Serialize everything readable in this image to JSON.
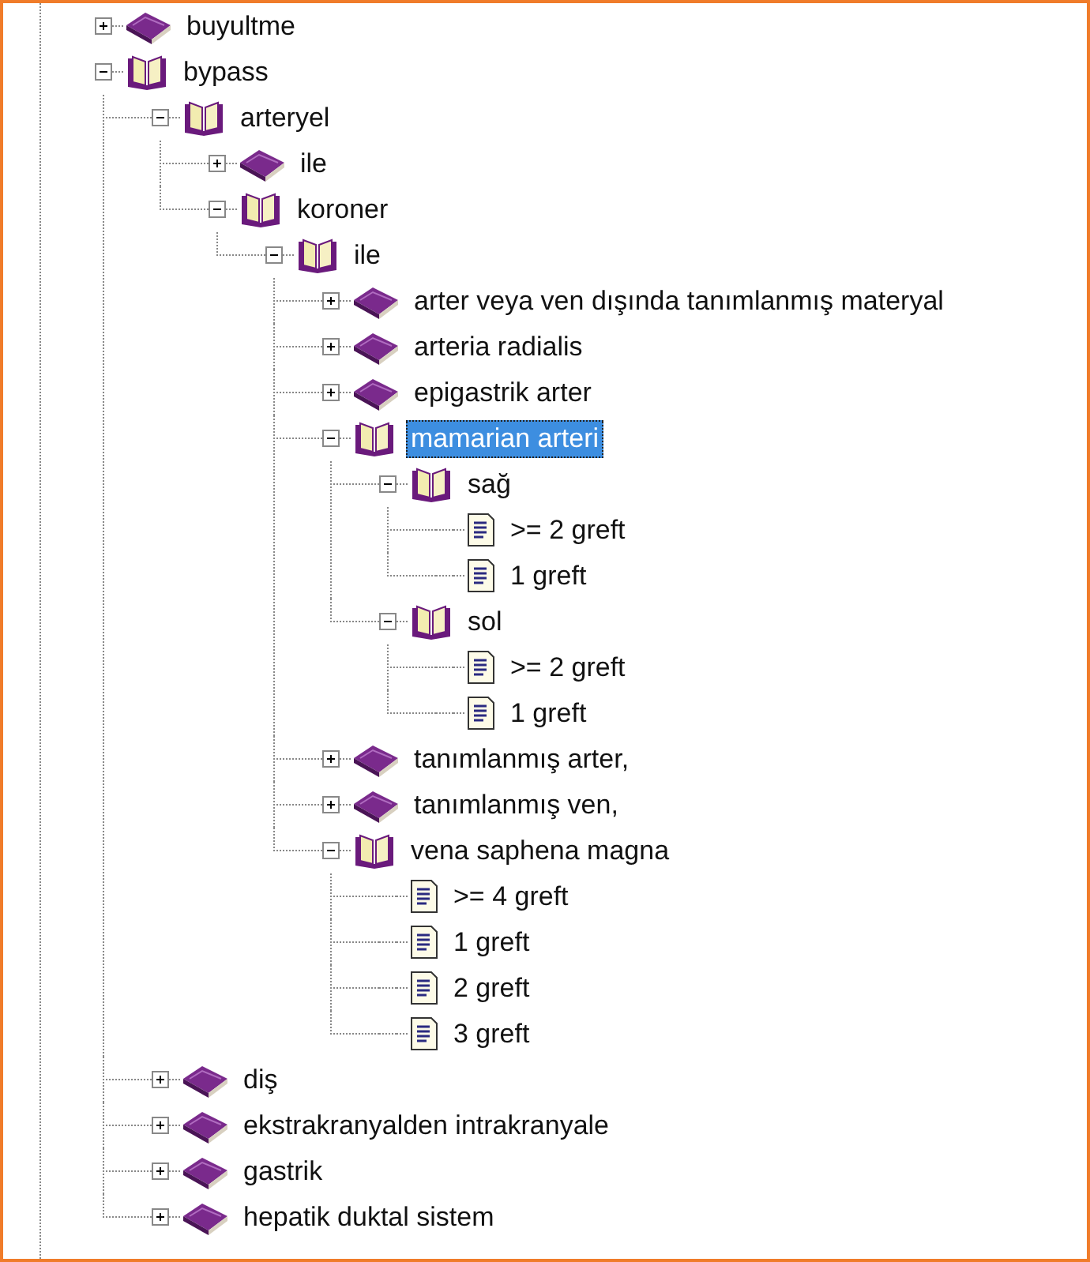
{
  "tree": [
    {
      "label": "buyultme",
      "kind": "book",
      "expanded": false,
      "selected": false
    },
    {
      "label": "bypass",
      "kind": "book",
      "expanded": true,
      "selected": false,
      "children": [
        {
          "label": "arteryel",
          "kind": "book",
          "expanded": true,
          "selected": false,
          "children": [
            {
              "label": "ile",
              "kind": "book",
              "expanded": false,
              "selected": false
            },
            {
              "label": "koroner",
              "kind": "book",
              "expanded": true,
              "selected": false,
              "children": [
                {
                  "label": "ile",
                  "kind": "book",
                  "expanded": true,
                  "selected": false,
                  "children": [
                    {
                      "label": "arter veya ven dışında tanımlanmış materyal",
                      "kind": "book",
                      "expanded": false,
                      "selected": false
                    },
                    {
                      "label": "arteria radialis",
                      "kind": "book",
                      "expanded": false,
                      "selected": false
                    },
                    {
                      "label": "epigastrik arter",
                      "kind": "book",
                      "expanded": false,
                      "selected": false
                    },
                    {
                      "label": "mamarian arteri",
                      "kind": "book",
                      "expanded": true,
                      "selected": true,
                      "children": [
                        {
                          "label": "sağ",
                          "kind": "book",
                          "expanded": true,
                          "selected": false,
                          "children": [
                            {
                              "label": ">= 2 greft",
                              "kind": "page",
                              "selected": false
                            },
                            {
                              "label": "1 greft",
                              "kind": "page",
                              "selected": false
                            }
                          ]
                        },
                        {
                          "label": "sol",
                          "kind": "book",
                          "expanded": true,
                          "selected": false,
                          "children": [
                            {
                              "label": ">= 2 greft",
                              "kind": "page",
                              "selected": false
                            },
                            {
                              "label": "1 greft",
                              "kind": "page",
                              "selected": false
                            }
                          ]
                        }
                      ]
                    },
                    {
                      "label": "tanımlanmış arter,",
                      "kind": "book",
                      "expanded": false,
                      "selected": false
                    },
                    {
                      "label": "tanımlanmış ven,",
                      "kind": "book",
                      "expanded": false,
                      "selected": false
                    },
                    {
                      "label": "vena saphena magna",
                      "kind": "book",
                      "expanded": true,
                      "selected": false,
                      "children": [
                        {
                          "label": ">= 4 greft",
                          "kind": "page",
                          "selected": false
                        },
                        {
                          "label": "1 greft",
                          "kind": "page",
                          "selected": false
                        },
                        {
                          "label": "2 greft",
                          "kind": "page",
                          "selected": false
                        },
                        {
                          "label": "3 greft",
                          "kind": "page",
                          "selected": false
                        }
                      ]
                    }
                  ]
                }
              ]
            }
          ]
        },
        {
          "label": "diş",
          "kind": "book",
          "expanded": false,
          "selected": false
        },
        {
          "label": "ekstrakranyalden intrakranyale",
          "kind": "book",
          "expanded": false,
          "selected": false
        },
        {
          "label": "gastrik",
          "kind": "book",
          "expanded": false,
          "selected": false
        },
        {
          "label": "hepatik duktal sistem",
          "kind": "book",
          "expanded": false,
          "selected": false
        }
      ]
    }
  ]
}
